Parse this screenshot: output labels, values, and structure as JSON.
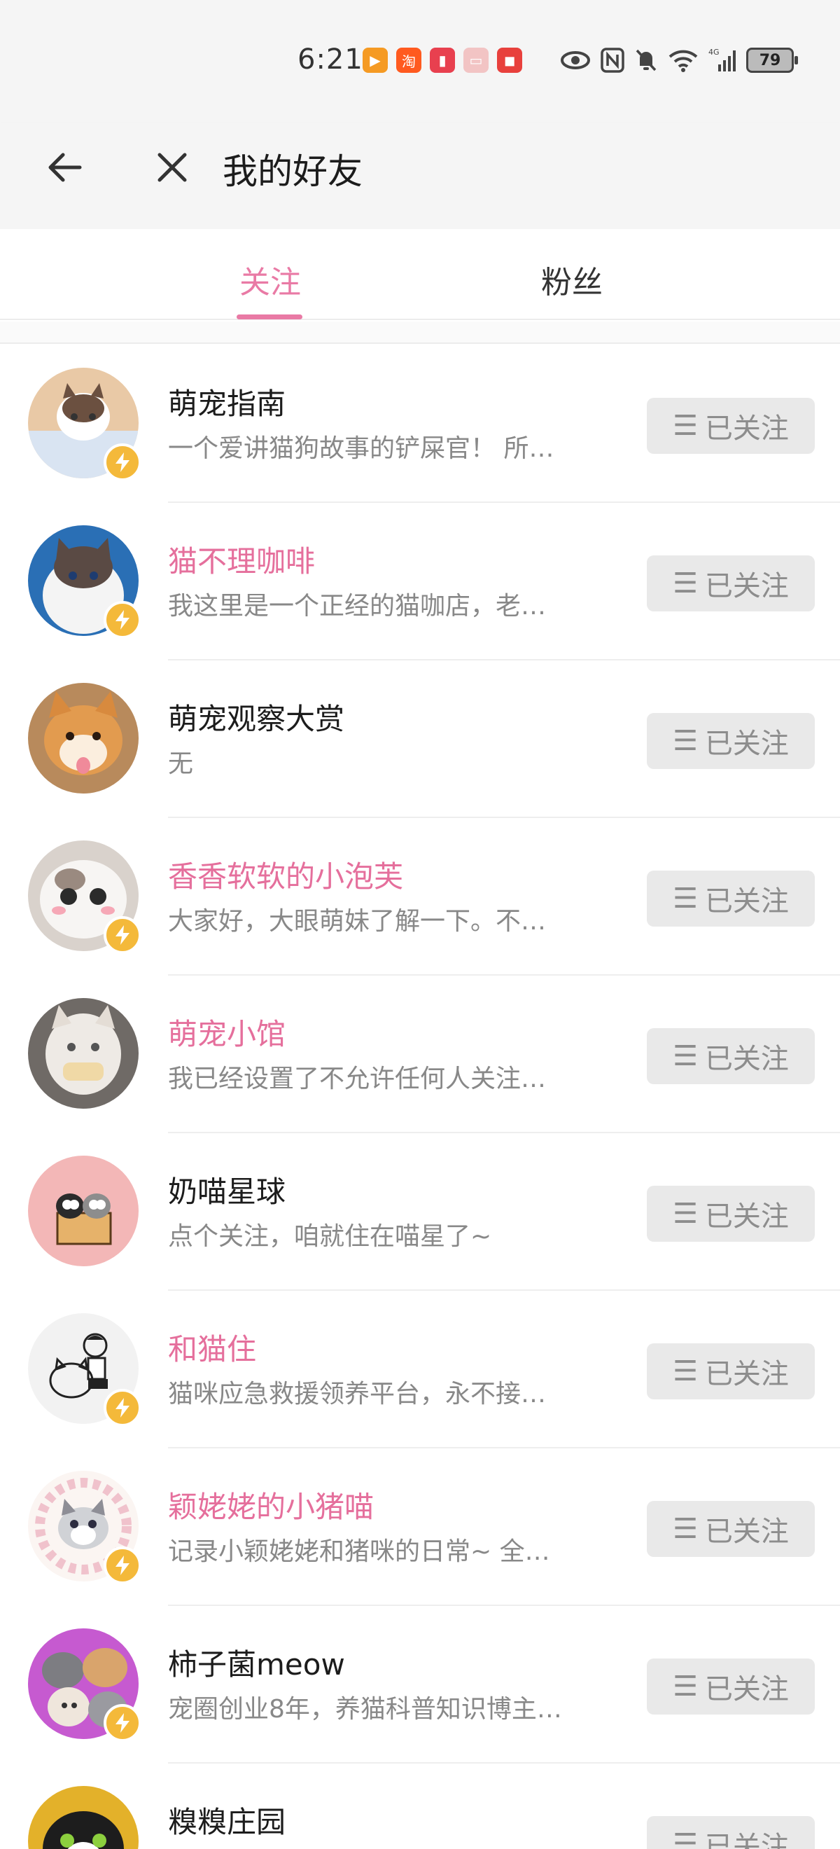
{
  "status_bar": {
    "time": "6:21",
    "battery": "79",
    "network": "4G",
    "app_icons": [
      "video-app-icon",
      "taobao-icon",
      "book-app-icon",
      "calendar-app-icon",
      "huawei-app-icon"
    ],
    "system_icons": [
      "eye-icon",
      "nfc-icon",
      "mute-icon",
      "wifi-icon",
      "signal-icon"
    ]
  },
  "header": {
    "title": "我的好友",
    "back_icon": "arrow-left-icon",
    "close_icon": "close-icon"
  },
  "tabs": [
    {
      "label": "关注",
      "active": true
    },
    {
      "label": "粉丝",
      "active": false
    }
  ],
  "colors": {
    "accent": "#e97aa5",
    "name_highlight": "#e56f9c",
    "badge": "#f4b93a",
    "button_bg": "#e9e9e9"
  },
  "follow_button_label": "已关注",
  "list": [
    {
      "name": "萌宠指南",
      "desc": "一个爱讲猫狗故事的铲屎官！ 所…",
      "highlight": false,
      "verified": true
    },
    {
      "name": "猫不理咖啡",
      "desc": "我这里是一个正经的猫咖店，老…",
      "highlight": true,
      "verified": true
    },
    {
      "name": "萌宠观察大赏",
      "desc": "无",
      "highlight": false,
      "verified": false
    },
    {
      "name": "香香软软的小泡芙",
      "desc": "大家好，大眼萌妹了解一下。不…",
      "highlight": true,
      "verified": true
    },
    {
      "name": "萌宠小馆",
      "desc": "我已经设置了不允许任何人关注…",
      "highlight": true,
      "verified": false
    },
    {
      "name": "奶喵星球",
      "desc": "点个关注，咱就住在喵星了~",
      "highlight": false,
      "verified": false
    },
    {
      "name": "和猫住",
      "desc": "猫咪应急救援领养平台，永不接…",
      "highlight": true,
      "verified": true
    },
    {
      "name": "颖姥姥的小猪喵",
      "desc": "记录小颖姥姥和猪咪的日常~ 全…",
      "highlight": true,
      "verified": true
    },
    {
      "name": "柿子菌meow",
      "desc": "宠圈创业8年，养猫科普知识博主…",
      "highlight": false,
      "verified": true
    },
    {
      "name": "糗糗庄园",
      "desc": "",
      "highlight": false,
      "verified": false
    }
  ]
}
